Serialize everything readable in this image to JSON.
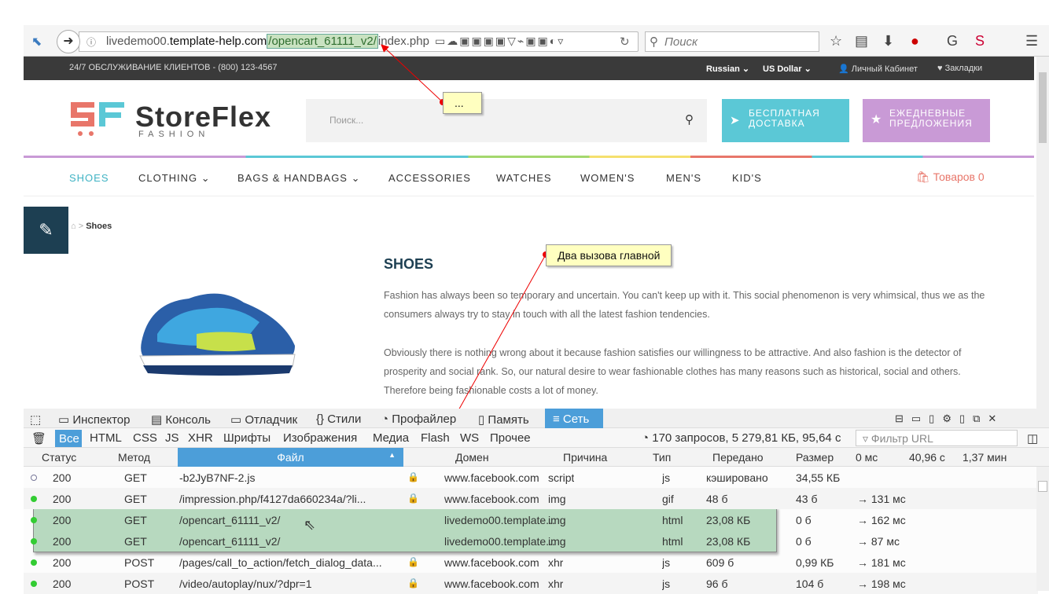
{
  "browser": {
    "url_prefix": "livedemo00.",
    "url_domain": "template-help.com",
    "url_path_hl": "/opencart_61111_v2/",
    "url_rest": "index.php",
    "search_placeholder": "Поиск"
  },
  "site": {
    "topbar_left": "24/7 ОБСЛУЖИВАНИЕ КЛИЕНТОВ - (800) 123-4567",
    "lang": "Russian",
    "currency": "US Dollar",
    "account": "Личный Кабинет",
    "wishlist": "Закладки",
    "logo": "StoreFlex",
    "logo_sub": "FASHION",
    "search_placeholder": "Поиск...",
    "promo1": [
      "БЕСПЛАТНАЯ",
      "ДОСТАВКА"
    ],
    "promo2": [
      "ЕЖЕДНЕВНЫЕ",
      "ПРЕДЛОЖЕНИЯ"
    ],
    "nav": [
      "SHOES",
      "CLOTHING",
      "BAGS & HANDBAGS",
      "ACCESSORIES",
      "WATCHES",
      "WOMEN'S",
      "MEN'S",
      "KID'S"
    ],
    "cart": "Товаров 0",
    "breadcrumb": "Shoes",
    "heading": "SHOES",
    "p1": "Fashion has always been so temporary and uncertain. You can't keep up with it. This social phenomenon is very whimsical, thus we as the consumers always try to stay in touch with all the latest fashion tendencies.",
    "p2": "Obviously there is nothing wrong about it because fashion satisfies our willingness to be attractive. And also fashion is the detector of prosperity and social rank. So, our natural desire to wear fashionable clothes has many reasons such as historical, social and others. Therefore being fashionable costs a lot of money."
  },
  "annotations": {
    "note1": "...",
    "note2": "Два вызова главной"
  },
  "devtools": {
    "tabs": [
      "Инспектор",
      "Консоль",
      "Отладчик",
      "Стили",
      "Профайлер",
      "Память",
      "Сеть"
    ],
    "filters": [
      "Все",
      "HTML",
      "CSS",
      "JS",
      "XHR",
      "Шрифты",
      "Изображения",
      "Медиа",
      "Flash",
      "WS",
      "Прочее"
    ],
    "summary": "170 запросов, 5 279,81 КБ, 95,64 с",
    "filter_url": "Фильтр URL",
    "columns": [
      "Статус",
      "Метод",
      "Файл",
      "Домен",
      "Причина",
      "Тип",
      "Передано",
      "Размер",
      "0 мс",
      "40,96 с",
      "1,37 мин"
    ],
    "rows": [
      {
        "status": "200",
        "method": "GET",
        "file": "-b2JyB7NF-2.js",
        "domain": "www.facebook.com",
        "cause": "script",
        "type": "js",
        "transferred": "кэшировано",
        "size": "34,55 КБ",
        "time": ""
      },
      {
        "status": "200",
        "method": "GET",
        "file": "/impression.php/f4127da660234a/?li...",
        "domain": "www.facebook.com",
        "cause": "img",
        "type": "gif",
        "transferred": "48 б",
        "size": "43 б",
        "time": "→ 131 мс"
      },
      {
        "status": "200",
        "method": "GET",
        "file": "/opencart_61111_v2/",
        "domain": "livedemo00.template...",
        "cause": "img",
        "type": "html",
        "transferred": "23,08 КБ",
        "size": "0 б",
        "time": "→ 162 мс"
      },
      {
        "status": "200",
        "method": "GET",
        "file": "/opencart_61111_v2/",
        "domain": "livedemo00.template...",
        "cause": "img",
        "type": "html",
        "transferred": "23,08 КБ",
        "size": "0 б",
        "time": "→ 87 мс"
      },
      {
        "status": "200",
        "method": "POST",
        "file": "/pages/call_to_action/fetch_dialog_data...",
        "domain": "www.facebook.com",
        "cause": "xhr",
        "type": "js",
        "transferred": "609 б",
        "size": "0,99 КБ",
        "time": "→ 181 мс"
      },
      {
        "status": "200",
        "method": "POST",
        "file": "/video/autoplay/nux/?dpr=1",
        "domain": "www.facebook.com",
        "cause": "xhr",
        "type": "js",
        "transferred": "96 б",
        "size": "104 б",
        "time": "→ 198 мс"
      }
    ]
  }
}
